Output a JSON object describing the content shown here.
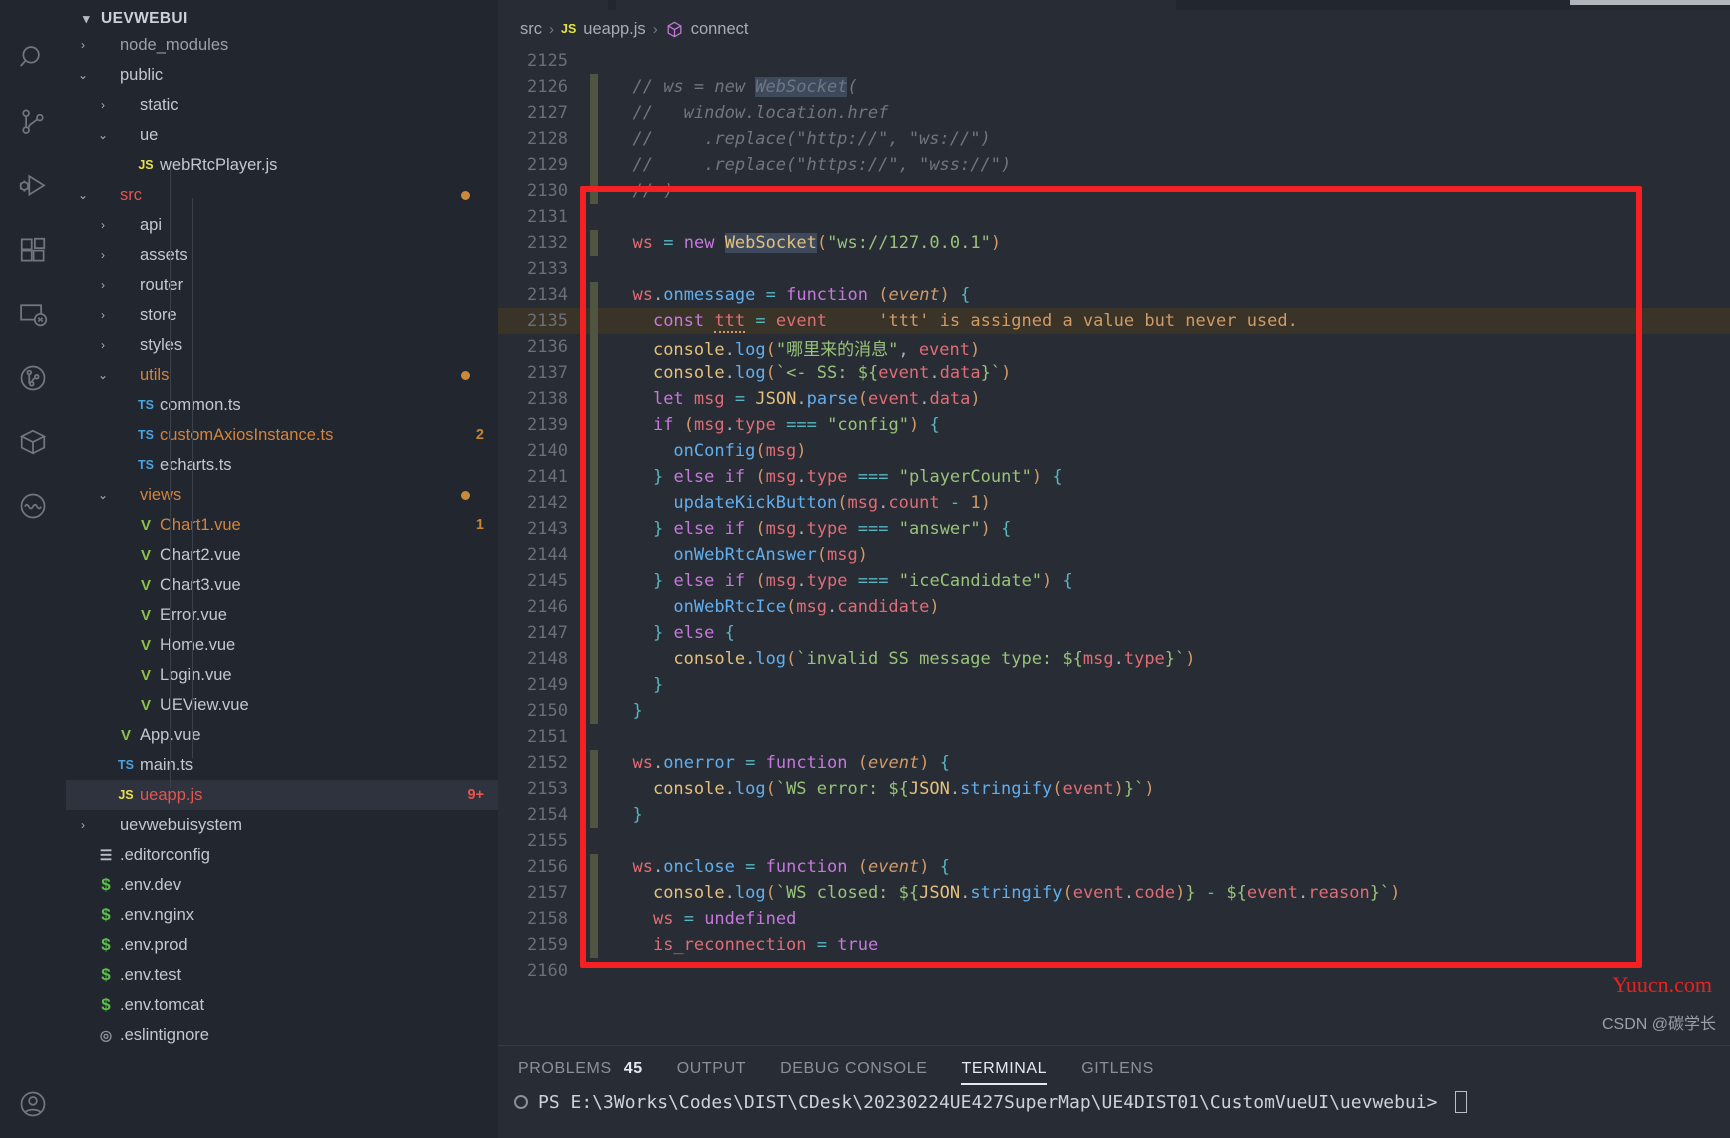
{
  "activity_bar": {
    "icons": [
      {
        "name": "search-icon",
        "label": "Search"
      },
      {
        "name": "source-control-icon",
        "label": "Source Control"
      },
      {
        "name": "run-and-debug-icon",
        "label": "Run and Debug"
      },
      {
        "name": "extensions-icon",
        "label": "Extensions"
      },
      {
        "name": "remote-explorer-icon",
        "label": "Remote Explorer"
      },
      {
        "name": "gitlens-icon",
        "label": "GitLens"
      },
      {
        "name": "package-explorer-icon",
        "label": "Package Explorer"
      },
      {
        "name": "wave-icon",
        "label": "Live Share"
      }
    ],
    "bottom_icon": {
      "name": "account-icon",
      "label": "Accounts"
    }
  },
  "sidebar": {
    "title": "UEVWEBUI",
    "tree": [
      {
        "label": "node_modules",
        "depth": 1,
        "kind": "folder",
        "twist": "collapsed",
        "color": "dim",
        "icon": "",
        "cut": true
      },
      {
        "label": "public",
        "depth": 1,
        "kind": "folder",
        "twist": "expanded",
        "color": "plain",
        "icon": ""
      },
      {
        "label": "static",
        "depth": 2,
        "kind": "folder",
        "twist": "collapsed",
        "color": "plain",
        "icon": ""
      },
      {
        "label": "ue",
        "depth": 2,
        "kind": "folder",
        "twist": "expanded",
        "color": "plain",
        "icon": ""
      },
      {
        "label": "webRtcPlayer.js",
        "depth": 3,
        "kind": "file",
        "twist": "none",
        "color": "plain",
        "icon": "JS",
        "icon_class": "js"
      },
      {
        "label": "src",
        "depth": 1,
        "kind": "folder",
        "twist": "expanded",
        "color": "folder-c",
        "icon": "",
        "dot": "orange"
      },
      {
        "label": "api",
        "depth": 2,
        "kind": "folder",
        "twist": "collapsed",
        "color": "plain",
        "icon": ""
      },
      {
        "label": "assets",
        "depth": 2,
        "kind": "folder",
        "twist": "collapsed",
        "color": "plain",
        "icon": ""
      },
      {
        "label": "router",
        "depth": 2,
        "kind": "folder",
        "twist": "collapsed",
        "color": "plain",
        "icon": ""
      },
      {
        "label": "store",
        "depth": 2,
        "kind": "folder",
        "twist": "collapsed",
        "color": "plain",
        "icon": ""
      },
      {
        "label": "styles",
        "depth": 2,
        "kind": "folder",
        "twist": "collapsed",
        "color": "plain",
        "icon": ""
      },
      {
        "label": "utils",
        "depth": 2,
        "kind": "folder",
        "twist": "expanded",
        "color": "folder-o",
        "icon": "",
        "dot": "orange"
      },
      {
        "label": "common.ts",
        "depth": 3,
        "kind": "file",
        "twist": "none",
        "color": "plain",
        "icon": "TS",
        "icon_class": "ts"
      },
      {
        "label": "customAxiosInstance.ts",
        "depth": 3,
        "kind": "file",
        "twist": "none",
        "color": "mod",
        "icon": "TS",
        "icon_class": "ts",
        "badge": "2"
      },
      {
        "label": "echarts.ts",
        "depth": 3,
        "kind": "file",
        "twist": "none",
        "color": "plain",
        "icon": "TS",
        "icon_class": "ts"
      },
      {
        "label": "views",
        "depth": 2,
        "kind": "folder",
        "twist": "expanded",
        "color": "folder-o",
        "icon": "",
        "dot": "orange"
      },
      {
        "label": "Chart1.vue",
        "depth": 3,
        "kind": "file",
        "twist": "none",
        "color": "mod",
        "icon": "V",
        "icon_class": "vue",
        "badge": "1"
      },
      {
        "label": "Chart2.vue",
        "depth": 3,
        "kind": "file",
        "twist": "none",
        "color": "plain",
        "icon": "V",
        "icon_class": "vue"
      },
      {
        "label": "Chart3.vue",
        "depth": 3,
        "kind": "file",
        "twist": "none",
        "color": "plain",
        "icon": "V",
        "icon_class": "vue"
      },
      {
        "label": "Error.vue",
        "depth": 3,
        "kind": "file",
        "twist": "none",
        "color": "plain",
        "icon": "V",
        "icon_class": "vue"
      },
      {
        "label": "Home.vue",
        "depth": 3,
        "kind": "file",
        "twist": "none",
        "color": "plain",
        "icon": "V",
        "icon_class": "vue"
      },
      {
        "label": "Login.vue",
        "depth": 3,
        "kind": "file",
        "twist": "none",
        "color": "plain",
        "icon": "V",
        "icon_class": "vue"
      },
      {
        "label": "UEView.vue",
        "depth": 3,
        "kind": "file",
        "twist": "none",
        "color": "plain",
        "icon": "V",
        "icon_class": "vue"
      },
      {
        "label": "App.vue",
        "depth": 2,
        "kind": "file",
        "twist": "none",
        "color": "plain",
        "icon": "V",
        "icon_class": "vue"
      },
      {
        "label": "main.ts",
        "depth": 2,
        "kind": "file",
        "twist": "none",
        "color": "plain",
        "icon": "TS",
        "icon_class": "ts"
      },
      {
        "label": "ueapp.js",
        "depth": 2,
        "kind": "file",
        "twist": "none",
        "color": "del",
        "icon": "JS",
        "icon_class": "js",
        "badge": "9+",
        "badge_class": "red",
        "selected": true
      },
      {
        "label": "uevwebuisystem",
        "depth": 1,
        "kind": "folder",
        "twist": "collapsed",
        "color": "plain",
        "icon": ""
      },
      {
        "label": ".editorconfig",
        "depth": 1,
        "kind": "file",
        "twist": "none",
        "color": "plain",
        "icon": "☰",
        "icon_class": "cfg"
      },
      {
        "label": ".env.dev",
        "depth": 1,
        "kind": "file",
        "twist": "none",
        "color": "plain",
        "icon": "$",
        "icon_class": "env"
      },
      {
        "label": ".env.nginx",
        "depth": 1,
        "kind": "file",
        "twist": "none",
        "color": "plain",
        "icon": "$",
        "icon_class": "env"
      },
      {
        "label": ".env.prod",
        "depth": 1,
        "kind": "file",
        "twist": "none",
        "color": "plain",
        "icon": "$",
        "icon_class": "env"
      },
      {
        "label": ".env.test",
        "depth": 1,
        "kind": "file",
        "twist": "none",
        "color": "plain",
        "icon": "$",
        "icon_class": "env"
      },
      {
        "label": ".env.tomcat",
        "depth": 1,
        "kind": "file",
        "twist": "none",
        "color": "plain",
        "icon": "$",
        "icon_class": "env"
      },
      {
        "label": ".eslintignore",
        "depth": 1,
        "kind": "file",
        "twist": "none",
        "color": "plain",
        "icon": "◎",
        "icon_class": "circ"
      }
    ]
  },
  "breadcrumb": {
    "parts": [
      {
        "text": "src",
        "icon": ""
      },
      {
        "text": "ueapp.js",
        "icon": "JS"
      },
      {
        "text": "connect",
        "icon": "cube"
      }
    ],
    "separator": "›"
  },
  "editor": {
    "first_line_number": 2125,
    "lines": [
      {
        "n": 2125,
        "mod": false,
        "html": ""
      },
      {
        "n": 2126,
        "mod": true,
        "html": "  <span class='t-com'>// ws = new </span><span class='t-com hl-occ'>WebSocket</span><span class='t-com'>(</span>"
      },
      {
        "n": 2127,
        "mod": true,
        "html": "  <span class='t-com'>//   window.location.href</span>"
      },
      {
        "n": 2128,
        "mod": true,
        "html": "  <span class='t-com'>//     .replace(\"http://\", \"ws://\")</span>"
      },
      {
        "n": 2129,
        "mod": true,
        "html": "  <span class='t-com'>//     .replace(\"https://\", \"wss://\")</span>"
      },
      {
        "n": 2130,
        "mod": true,
        "html": "  <span class='t-com'>// )</span>"
      },
      {
        "n": 2131,
        "mod": false,
        "html": ""
      },
      {
        "n": 2132,
        "mod": true,
        "html": "  <span class='t-var'>ws</span> <span class='t-op'>=</span> <span class='t-kw'>new</span> <span class='t-cls hl-occ'>WebSocket</span><span class='t-par'>(</span><span class='t-str'>\"ws://127.0.0.1\"</span><span class='t-par'>)</span>"
      },
      {
        "n": 2133,
        "mod": false,
        "html": ""
      },
      {
        "n": 2134,
        "mod": true,
        "html": "  <span class='t-var'>ws</span><span class='t-punc'>.</span><span class='t-fn'>onmessage</span> <span class='t-op'>=</span> <span class='t-kw'>function</span> <span class='t-par'>(</span><span class='t-param'>event</span><span class='t-par'>)</span> <span class='t-brc'>{</span>"
      },
      {
        "n": 2135,
        "mod": true,
        "warn": true,
        "html": "    <span class='t-kw'>const</span> <span class='t-var squig'>ttt</span> <span class='t-op'>=</span> <span class='t-var'>event</span>     <span class='t-warn'>'ttt' is assigned a value but never used.</span>"
      },
      {
        "n": 2136,
        "mod": true,
        "html": "    <span class='t-cls'>console</span><span class='t-punc'>.</span><span class='t-fn'>log</span><span class='t-par'>(</span><span class='t-str'>\"哪里来的消息\"</span><span class='t-punc'>,</span> <span class='t-var'>event</span><span class='t-par'>)</span>"
      },
      {
        "n": 2137,
        "mod": true,
        "html": "    <span class='t-cls'>console</span><span class='t-punc'>.</span><span class='t-fn'>log</span><span class='t-par'>(</span><span class='t-str'>`&lt;- SS: ${</span><span class='t-var'>event</span><span class='t-punc'>.</span><span class='t-prop'>data</span><span class='t-str'>}`</span><span class='t-par'>)</span>"
      },
      {
        "n": 2138,
        "mod": true,
        "html": "    <span class='t-kw'>let</span> <span class='t-var'>msg</span> <span class='t-op'>=</span> <span class='t-cls'>JSON</span><span class='t-punc'>.</span><span class='t-fn'>parse</span><span class='t-par'>(</span><span class='t-var'>event</span><span class='t-punc'>.</span><span class='t-prop'>data</span><span class='t-par'>)</span>"
      },
      {
        "n": 2139,
        "mod": true,
        "html": "    <span class='t-kw'>if</span> <span class='t-par'>(</span><span class='t-var'>msg</span><span class='t-punc'>.</span><span class='t-prop'>type</span> <span class='t-op'>===</span> <span class='t-str'>\"config\"</span><span class='t-par'>)</span> <span class='t-brc'>{</span>"
      },
      {
        "n": 2140,
        "mod": true,
        "html": "      <span class='t-fn'>onConfig</span><span class='t-par'>(</span><span class='t-var'>msg</span><span class='t-par'>)</span>"
      },
      {
        "n": 2141,
        "mod": true,
        "html": "    <span class='t-brc'>}</span> <span class='t-kw'>else if</span> <span class='t-par'>(</span><span class='t-var'>msg</span><span class='t-punc'>.</span><span class='t-prop'>type</span> <span class='t-op'>===</span> <span class='t-str'>\"playerCount\"</span><span class='t-par'>)</span> <span class='t-brc'>{</span>"
      },
      {
        "n": 2142,
        "mod": true,
        "html": "      <span class='t-fn'>updateKickButton</span><span class='t-par'>(</span><span class='t-var'>msg</span><span class='t-punc'>.</span><span class='t-prop'>count</span> <span class='t-op'>-</span> <span class='t-num'>1</span><span class='t-par'>)</span>"
      },
      {
        "n": 2143,
        "mod": true,
        "html": "    <span class='t-brc'>}</span> <span class='t-kw'>else if</span> <span class='t-par'>(</span><span class='t-var'>msg</span><span class='t-punc'>.</span><span class='t-prop'>type</span> <span class='t-op'>===</span> <span class='t-str'>\"answer\"</span><span class='t-par'>)</span> <span class='t-brc'>{</span>"
      },
      {
        "n": 2144,
        "mod": true,
        "html": "      <span class='t-fn'>onWebRtcAnswer</span><span class='t-par'>(</span><span class='t-var'>msg</span><span class='t-par'>)</span>"
      },
      {
        "n": 2145,
        "mod": true,
        "html": "    <span class='t-brc'>}</span> <span class='t-kw'>else if</span> <span class='t-par'>(</span><span class='t-var'>msg</span><span class='t-punc'>.</span><span class='t-prop'>type</span> <span class='t-op'>===</span> <span class='t-str'>\"iceCandidate\"</span><span class='t-par'>)</span> <span class='t-brc'>{</span>"
      },
      {
        "n": 2146,
        "mod": true,
        "html": "      <span class='t-fn'>onWebRtcIce</span><span class='t-par'>(</span><span class='t-var'>msg</span><span class='t-punc'>.</span><span class='t-prop'>candidate</span><span class='t-par'>)</span>"
      },
      {
        "n": 2147,
        "mod": true,
        "html": "    <span class='t-brc'>}</span> <span class='t-kw'>else</span> <span class='t-brc'>{</span>"
      },
      {
        "n": 2148,
        "mod": true,
        "html": "      <span class='t-cls'>console</span><span class='t-punc'>.</span><span class='t-fn'>log</span><span class='t-par'>(</span><span class='t-str'>`invalid SS message type: ${</span><span class='t-var'>msg</span><span class='t-punc'>.</span><span class='t-prop'>type</span><span class='t-str'>}`</span><span class='t-par'>)</span>"
      },
      {
        "n": 2149,
        "mod": true,
        "html": "    <span class='t-brc'>}</span>"
      },
      {
        "n": 2150,
        "mod": true,
        "html": "  <span class='t-brc'>}</span>"
      },
      {
        "n": 2151,
        "mod": false,
        "html": ""
      },
      {
        "n": 2152,
        "mod": true,
        "html": "  <span class='t-var'>ws</span><span class='t-punc'>.</span><span class='t-fn'>onerror</span> <span class='t-op'>=</span> <span class='t-kw'>function</span> <span class='t-par'>(</span><span class='t-param'>event</span><span class='t-par'>)</span> <span class='t-brc'>{</span>"
      },
      {
        "n": 2153,
        "mod": true,
        "html": "    <span class='t-cls'>console</span><span class='t-punc'>.</span><span class='t-fn'>log</span><span class='t-par'>(</span><span class='t-str'>`WS error: ${</span><span class='t-cls'>JSON</span><span class='t-punc'>.</span><span class='t-fn'>stringify</span><span class='t-par'>(</span><span class='t-var'>event</span><span class='t-par'>)</span><span class='t-str'>}`</span><span class='t-par'>)</span>"
      },
      {
        "n": 2154,
        "mod": true,
        "html": "  <span class='t-brc'>}</span>"
      },
      {
        "n": 2155,
        "mod": false,
        "html": ""
      },
      {
        "n": 2156,
        "mod": true,
        "html": "  <span class='t-var'>ws</span><span class='t-punc'>.</span><span class='t-fn'>onclose</span> <span class='t-op'>=</span> <span class='t-kw'>function</span> <span class='t-par'>(</span><span class='t-param'>event</span><span class='t-par'>)</span> <span class='t-brc'>{</span>"
      },
      {
        "n": 2157,
        "mod": true,
        "html": "    <span class='t-cls'>console</span><span class='t-punc'>.</span><span class='t-fn'>log</span><span class='t-par'>(</span><span class='t-str'>`WS closed: ${</span><span class='t-cls'>JSON</span><span class='t-punc'>.</span><span class='t-fn'>stringify</span><span class='t-par'>(</span><span class='t-var'>event</span><span class='t-punc'>.</span><span class='t-prop'>code</span><span class='t-par'>)</span><span class='t-str'>}</span> <span class='t-op'>-</span> <span class='t-str'>${</span><span class='t-var'>event</span><span class='t-punc'>.</span><span class='t-prop'>reason</span><span class='t-str'>}`</span><span class='t-par'>)</span>"
      },
      {
        "n": 2158,
        "mod": true,
        "html": "    <span class='t-var'>ws</span> <span class='t-op'>=</span> <span class='t-kw'>undefined</span>"
      },
      {
        "n": 2159,
        "mod": true,
        "html": "    <span class='t-var'>is_reconnection</span> <span class='t-op'>=</span> <span class='t-kw'>true</span>"
      },
      {
        "n": 2160,
        "mod": false,
        "html": ""
      }
    ],
    "highlight_box_color": "#f61f22"
  },
  "panel": {
    "tabs": [
      {
        "label": "PROBLEMS",
        "count": "45",
        "active": false
      },
      {
        "label": "OUTPUT",
        "count": "",
        "active": false
      },
      {
        "label": "DEBUG CONSOLE",
        "count": "",
        "active": false
      },
      {
        "label": "TERMINAL",
        "count": "",
        "active": true
      },
      {
        "label": "GITLENS",
        "count": "",
        "active": false
      }
    ],
    "terminal_prompt": "PS E:\\3Works\\Codes\\DIST\\CDesk\\20230224UE427SuperMap\\UE4DIST01\\CustomVueUI\\uevwebui>"
  },
  "watermarks": {
    "site": "Yuucn.com",
    "author": "CSDN @碳学长"
  }
}
